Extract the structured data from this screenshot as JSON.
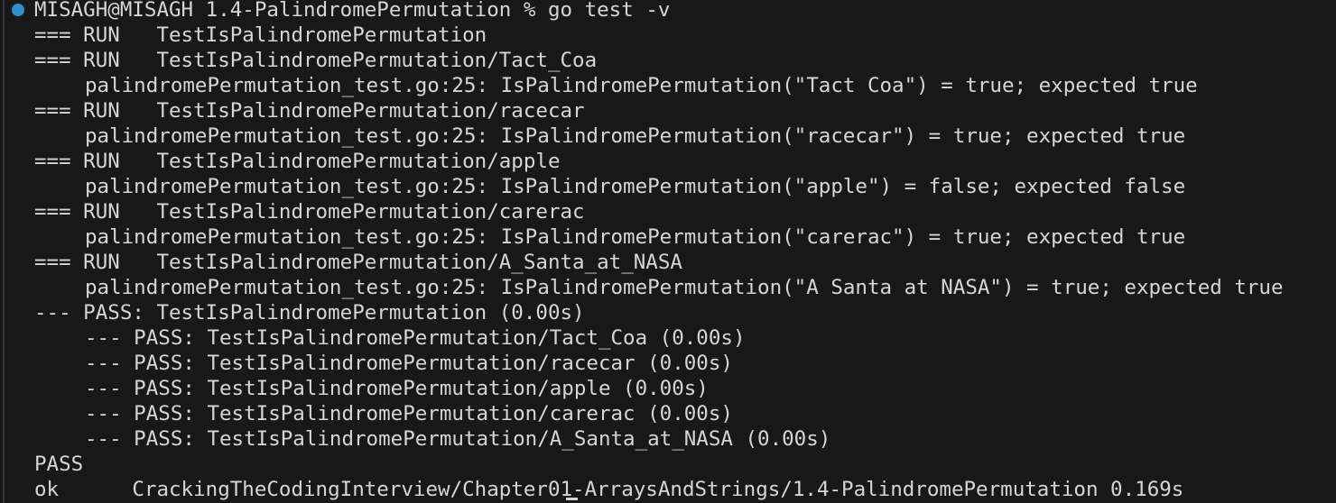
{
  "terminal": {
    "prompt": {
      "user_host": "MISAGH@MISAGH",
      "directory": "1.4-PalindromePermutation",
      "symbol": "%",
      "command": "go test -v"
    },
    "status_dot_color": "#2f8fce",
    "output": [
      {
        "indent": 1,
        "text": "=== RUN   TestIsPalindromePermutation"
      },
      {
        "indent": 1,
        "text": "=== RUN   TestIsPalindromePermutation/Tact_Coa"
      },
      {
        "indent": 2,
        "text": "palindromePermutation_test.go:25: IsPalindromePermutation(\"Tact Coa\") = true; expected true"
      },
      {
        "indent": 1,
        "text": "=== RUN   TestIsPalindromePermutation/racecar"
      },
      {
        "indent": 2,
        "text": "palindromePermutation_test.go:25: IsPalindromePermutation(\"racecar\") = true; expected true"
      },
      {
        "indent": 1,
        "text": "=== RUN   TestIsPalindromePermutation/apple"
      },
      {
        "indent": 2,
        "text": "palindromePermutation_test.go:25: IsPalindromePermutation(\"apple\") = false; expected false"
      },
      {
        "indent": 1,
        "text": "=== RUN   TestIsPalindromePermutation/carerac"
      },
      {
        "indent": 2,
        "text": "palindromePermutation_test.go:25: IsPalindromePermutation(\"carerac\") = true; expected true"
      },
      {
        "indent": 1,
        "text": "=== RUN   TestIsPalindromePermutation/A_Santa_at_NASA"
      },
      {
        "indent": 2,
        "text": "palindromePermutation_test.go:25: IsPalindromePermutation(\"A Santa at NASA\") = true; expected true"
      },
      {
        "indent": 1,
        "text": "--- PASS: TestIsPalindromePermutation (0.00s)"
      },
      {
        "indent": 2,
        "text": "--- PASS: TestIsPalindromePermutation/Tact_Coa (0.00s)"
      },
      {
        "indent": 2,
        "text": "--- PASS: TestIsPalindromePermutation/racecar (0.00s)"
      },
      {
        "indent": 2,
        "text": "--- PASS: TestIsPalindromePermutation/apple (0.00s)"
      },
      {
        "indent": 2,
        "text": "--- PASS: TestIsPalindromePermutation/carerac (0.00s)"
      },
      {
        "indent": 2,
        "text": "--- PASS: TestIsPalindromePermutation/A_Santa_at_NASA (0.00s)"
      },
      {
        "indent": 1,
        "text": "PASS"
      },
      {
        "indent": 1,
        "text": "ok      CrackingTheCodingInterview/Chapter01-ArraysAndStrings/1.4-PalindromePermutation 0.169s"
      }
    ]
  }
}
